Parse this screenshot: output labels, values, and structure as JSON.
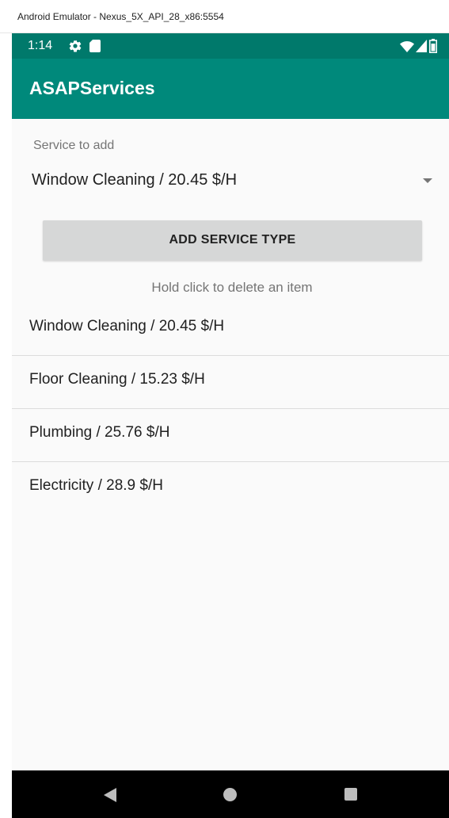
{
  "window": {
    "title": "Android Emulator - Nexus_5X_API_28_x86:5554"
  },
  "status_bar": {
    "time": "1:14",
    "icons": [
      "gear-icon",
      "sd-card-icon",
      "wifi-icon",
      "signal-icon",
      "battery-icon"
    ]
  },
  "app_bar": {
    "title": "ASAPServices"
  },
  "form": {
    "label": "Service to add",
    "selected_service": "Window Cleaning / 20.45 $/H",
    "add_button_label": "ADD SERVICE TYPE",
    "hint": "Hold click to delete an item"
  },
  "services": [
    {
      "label": "Window Cleaning / 20.45 $/H"
    },
    {
      "label": "Floor Cleaning / 15.23 $/H"
    },
    {
      "label": "Plumbing / 25.76 $/H"
    },
    {
      "label": "Electricity / 28.9 $/H"
    }
  ],
  "nav_bar": {
    "icons": [
      "back-icon",
      "home-icon",
      "recents-icon"
    ]
  },
  "colors": {
    "status_bar": "#00796b",
    "app_bar": "#00897b",
    "button": "#d6d7d7",
    "background": "#fafafa",
    "nav_bar": "#000000"
  }
}
